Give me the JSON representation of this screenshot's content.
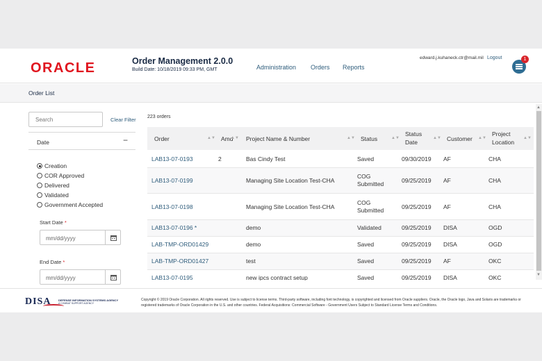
{
  "header": {
    "logo_text": "ORACLE",
    "app_title": "Order Management 2.0.0",
    "build_date": "Build Date: 10/18/2019 09:33 PM, GMT",
    "nav": [
      "Administration",
      "Orders",
      "Reports"
    ],
    "user_email": "edward.j.kuhaneck.ctr@mail.mil",
    "logout_label": "Logout",
    "cart_count": "1"
  },
  "page": {
    "title": "Order List"
  },
  "sidebar": {
    "search_placeholder": "Search",
    "clear_filter_label": "Clear Filter",
    "date_group_label": "Date",
    "collapse_symbol": "−",
    "date_options": [
      "Creation",
      "COR Approved",
      "Delivered",
      "Validated",
      "Government Accepted"
    ],
    "selected_option": "Creation",
    "start_date_label": "Start Date",
    "end_date_label": "End Date",
    "required_marker": "*",
    "date_placeholder": "mm/dd/yyyy"
  },
  "table": {
    "order_count": "223 orders",
    "columns": [
      "Order",
      "Amd",
      "Project Name & Number",
      "Status",
      "Status Date",
      "Customer",
      "Project Location"
    ],
    "rows": [
      [
        "LAB13-07-0193",
        "2",
        "Bas Cindy Test",
        "Saved",
        "09/30/2019",
        "AF",
        "CHA"
      ],
      [
        "LAB13-07-0199",
        "",
        "Managing Site Location Test-CHA",
        "COG Submitted",
        "09/25/2019",
        "AF",
        "CHA"
      ],
      [
        "LAB13-07-0198",
        "",
        "Managing Site Location Test-CHA",
        "COG Submitted",
        "09/25/2019",
        "AF",
        "CHA"
      ],
      [
        "LAB13-07-0196 *",
        "",
        "demo",
        "Validated",
        "09/25/2019",
        "DISA",
        "OGD"
      ],
      [
        "LAB-TMP-ORD01429",
        "",
        "demo",
        "Saved",
        "09/25/2019",
        "DISA",
        "OGD"
      ],
      [
        "LAB-TMP-ORD01427",
        "",
        "test",
        "Saved",
        "09/25/2019",
        "AF",
        "OKC"
      ],
      [
        "LAB13-07-0195",
        "",
        "new ipcs contract setup",
        "Saved",
        "09/25/2019",
        "DISA",
        "OKC"
      ]
    ]
  },
  "footer": {
    "disa_logo": "DISA",
    "disa_name": "DEFENSE INFORMATION SYSTEMS AGENCY",
    "disa_sub": "A COMBAT SUPPORT AGENCY",
    "copyright": "Copyright © 2019 Oracle Corporation. All rights reserved. Use is subject to license terms. Third-party software, including font technology, is copyrighted and licensed from Oracle suppliers. Oracle, the Oracle logo, Java and Solaris are trademarks or registered trademarks of Oracle Corporation in the U.S. and other countries. Federal Acquisitions: Commercial Software - Government Users Subject to Standard License Terms and Conditions."
  },
  "colors": {
    "brand": "#e0141e",
    "link": "#2f5d7c",
    "badge": "#d9262c",
    "cart": "#2f6d93"
  },
  "icons": {
    "sort": "sort-arrows-icon",
    "calendar": "calendar-icon",
    "cart": "cart-icon"
  }
}
